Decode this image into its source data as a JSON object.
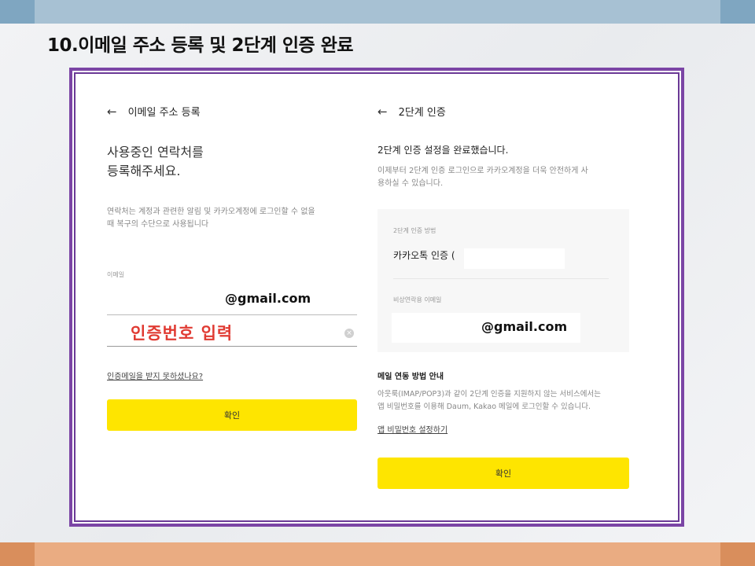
{
  "slide": {
    "title": "10.이메일 주소 등록 및 2단계 인증 완료"
  },
  "left": {
    "header": "이메일 주소 등록",
    "heading_line1": "사용중인 연락처를",
    "heading_line2": "등록해주세요.",
    "desc_line1": "연락처는 계정과 관련한 알림 및 카카오계정에 로그인할 수 없을",
    "desc_line2": "때 복구의 수단으로 사용됩니다",
    "email_label": "이메일",
    "email_value": "@gmail.com",
    "code_input": "인증번호 입력",
    "resend_link": "인증메일을 받지 못하셨나요?",
    "confirm_button": "확인"
  },
  "right": {
    "header": "2단계 인증",
    "heading": "2단계 인증 설정을 완료했습니다.",
    "desc_line1": "이제부터 2단계 인증 로그인으로 카카오계정을 더욱 안전하게 사",
    "desc_line2": "용하실 수 있습니다.",
    "method_label": "2단계 인증 방법",
    "method_value": "카카오톡 인증 (",
    "backup_label": "비상연락용 이메일",
    "backup_value": "@gmail.com",
    "mail_title": "메일 연동 방법 안내",
    "mail_desc_line1": "아웃룩(IMAP/POP3)과 같이 2단계 인증을 지원하지 않는 서비스에서는",
    "mail_desc_line2": "앱 비밀번호를 이용해 Daum, Kakao 메일에 로그인할 수 있습니다.",
    "app_pw_link": "앱 비밀번호 설정하기",
    "confirm_button": "확인"
  },
  "icons": {
    "back": "arrow-left-icon",
    "clear": "clear-circle-icon"
  },
  "colors": {
    "frame": "#7b45a5",
    "button": "#fee500",
    "highlight_text": "#e03a32"
  }
}
